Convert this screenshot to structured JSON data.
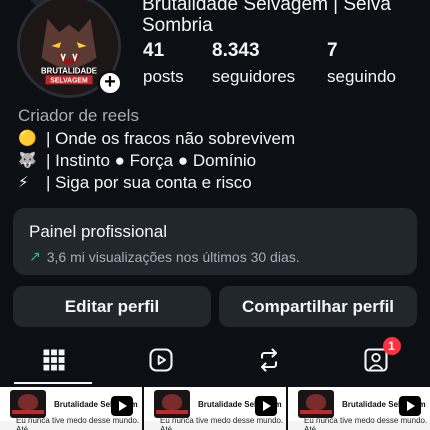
{
  "profile": {
    "name": "Brutalidade Selvagem | Selva Sombria",
    "category": "Criador de reels",
    "avatar_text_top": "BRUTALIDADE",
    "avatar_text_bottom": "SELVAGEM"
  },
  "stats": {
    "posts": {
      "value": "41",
      "label": "posts"
    },
    "followers": {
      "value": "8.343",
      "label": "seguidores"
    },
    "following": {
      "value": "7",
      "label": "seguindo"
    }
  },
  "bio": [
    {
      "icon": "yellow-circle-icon",
      "glyph": "🟡",
      "text": "| Onde os fracos não sobrevivem"
    },
    {
      "icon": "wolf-icon",
      "glyph": "🐺",
      "text": "| Instinto ● Força ● Domínio"
    },
    {
      "icon": "lightning-icon",
      "glyph": "⚡",
      "text": "| Siga por sua conta e risco"
    }
  ],
  "panel": {
    "title": "Painel profissional",
    "subtitle": "3,6 mi visualizações nos últimos 30 dias."
  },
  "actions": {
    "edit": "Editar perfil",
    "share": "Compartilhar perfil"
  },
  "tabs": [
    {
      "icon": "grid-icon",
      "active": true
    },
    {
      "icon": "reels-icon",
      "active": false
    },
    {
      "icon": "reposts-icon",
      "active": false
    },
    {
      "icon": "tagged-icon",
      "active": false,
      "badge": "1"
    }
  ],
  "grid": [
    {
      "title": "Brutalidade Selvagem",
      "caption": "Eu nunca tive medo desse mundo. Até"
    },
    {
      "title": "Brutalidade Selvagem",
      "caption": "Eu nunca tive medo desse mundo. Até"
    },
    {
      "title": "Brutalidade Selvagem",
      "caption": "Eu nunca tive medo desse mundo. Até"
    }
  ],
  "colors": {
    "background": "#0c0f14",
    "card": "#22262d",
    "accent_green": "#2fbf71",
    "badge_red": "#ff3040"
  }
}
